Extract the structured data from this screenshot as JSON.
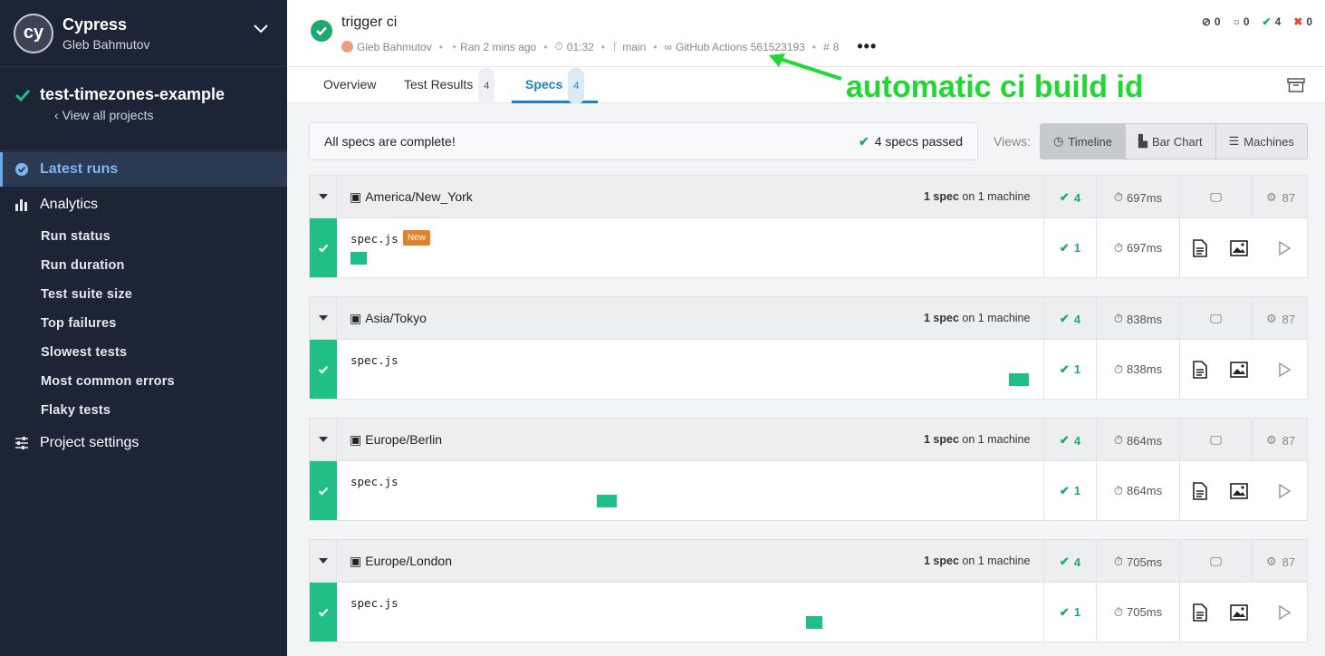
{
  "sidebar": {
    "org_logo": "cy",
    "org_name": "Cypress",
    "org_user": "Gleb Bahmutov",
    "project_name": "test-timezones-example",
    "view_all": "View all projects",
    "latest_runs": "Latest runs",
    "analytics": "Analytics",
    "analytics_items": [
      "Run status",
      "Run duration",
      "Test suite size",
      "Top failures",
      "Slowest tests",
      "Most common errors",
      "Flaky tests"
    ],
    "project_settings": "Project settings"
  },
  "header": {
    "title": "trigger ci",
    "author": "Gleb Bahmutov",
    "ran": "Ran 2 mins ago",
    "duration": "01:32",
    "branch": "main",
    "ci": "GitHub Actions 561523193",
    "run_number": "8",
    "counts": {
      "skipped": "0",
      "pending": "0",
      "passed": "4",
      "failed": "0"
    }
  },
  "tabs": {
    "overview": "Overview",
    "test_results": "Test Results",
    "test_results_count": "4",
    "specs": "Specs",
    "specs_count": "4"
  },
  "annotation": "automatic ci build id",
  "status": {
    "message": "All specs are complete!",
    "passed": "4 specs passed"
  },
  "views": {
    "label": "Views:",
    "timeline": "Timeline",
    "bar_chart": "Bar Chart",
    "machines": "Machines"
  },
  "groups": [
    {
      "name": "America/New_York",
      "spec_count": "1 spec",
      "machines": "on 1 machine",
      "passed": "4",
      "duration": "697ms",
      "score": "87",
      "spec": {
        "name": "spec.js",
        "badge": "New",
        "passed": "1",
        "duration": "697ms"
      }
    },
    {
      "name": "Asia/Tokyo",
      "spec_count": "1 spec",
      "machines": "on 1 machine",
      "passed": "4",
      "duration": "838ms",
      "score": "87",
      "spec": {
        "name": "spec.js",
        "passed": "1",
        "duration": "838ms"
      }
    },
    {
      "name": "Europe/Berlin",
      "spec_count": "1 spec",
      "machines": "on 1 machine",
      "passed": "4",
      "duration": "864ms",
      "score": "87",
      "spec": {
        "name": "spec.js",
        "passed": "1",
        "duration": "864ms"
      }
    },
    {
      "name": "Europe/London",
      "spec_count": "1 spec",
      "machines": "on 1 machine",
      "passed": "4",
      "duration": "705ms",
      "score": "87",
      "spec": {
        "name": "spec.js",
        "passed": "1",
        "duration": "705ms"
      }
    }
  ],
  "colors": {
    "pass": "#1fbf86",
    "accent": "#1c80d0",
    "sidebar": "#1b2535",
    "annotation": "#21d832"
  }
}
